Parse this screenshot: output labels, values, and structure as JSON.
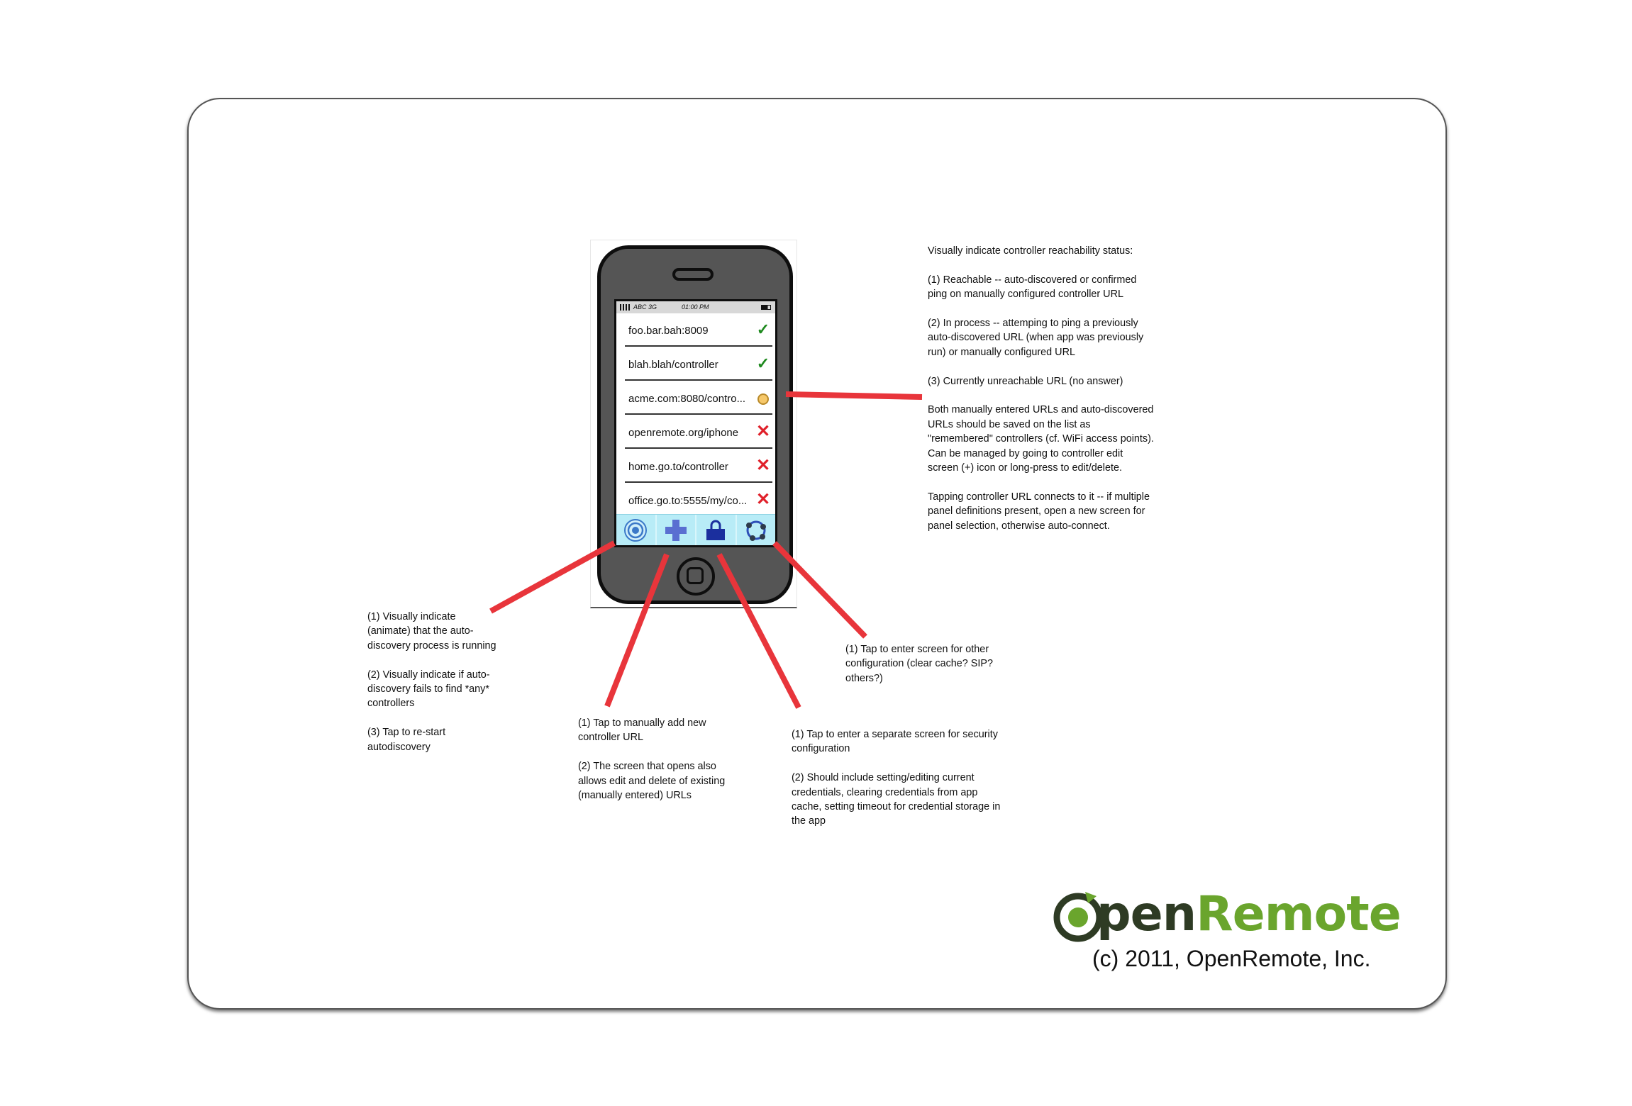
{
  "phone": {
    "status_bar": {
      "carrier": "ABC 3G",
      "time": "01:00 PM"
    },
    "controllers": [
      {
        "url": "foo.bar.bah:8009",
        "status": "reachable",
        "icon": "check-icon"
      },
      {
        "url": "blah.blah/controller",
        "status": "reachable",
        "icon": "check-icon"
      },
      {
        "url": "acme.com:8080/contro...",
        "status": "in-process",
        "icon": "pending-icon"
      },
      {
        "url": "openremote.org/iphone",
        "status": "unreachable",
        "icon": "cross-icon"
      },
      {
        "url": "home.go.to/controller",
        "status": "unreachable",
        "icon": "cross-icon"
      },
      {
        "url": "office.go.to:5555/my/co...",
        "status": "unreachable",
        "icon": "cross-icon"
      }
    ],
    "tabs": [
      {
        "icon": "autodiscovery-icon"
      },
      {
        "icon": "add-icon"
      },
      {
        "icon": "security-lock-icon"
      },
      {
        "icon": "settings-network-icon"
      }
    ],
    "status_symbols": {
      "check": "✓",
      "cross": "✕"
    },
    "colors": {
      "tab_bar": "#b8ecf7",
      "reachable": "#1f8a1f",
      "pending": "#f6c86a",
      "unreachable": "#e0202a",
      "callout": "#e8353b"
    }
  },
  "notes": {
    "reachability": [
      "Visually indicate controller reachability status:",
      "(1) Reachable -- auto-discovered or confirmed ping on manually configured controller URL",
      "(2) In process -- attemping to ping a previously auto-discovered URL (when app was previously run) or manually configured URL",
      "(3) Currently unreachable URL (no answer)",
      "Both manually entered URLs and auto-discovered URLs should be saved on the list as \"remembered\" controllers (cf. WiFi access points). Can be managed by going to controller edit screen (+) icon or long-press to edit/delete.",
      "Tapping controller URL connects to it -- if multiple panel definitions present, open a new screen for panel selection, otherwise auto-connect."
    ],
    "autodiscovery": [
      "(1) Visually indicate (animate) that the auto-discovery process is running",
      "(2) Visually indicate if auto-discovery fails to find *any* controllers",
      "(3) Tap to re-start autodiscovery"
    ],
    "add_controller": [
      "(1) Tap to manually add new controller URL",
      "(2) The screen that opens also allows edit and delete of existing (manually entered) URLs"
    ],
    "security": [
      "(1) Tap to enter a separate screen for security configuration",
      "(2) Should include setting/editing current credentials, clearing credentials from app cache, setting timeout for credential storage in the app"
    ],
    "other_config": [
      "(1) Tap to enter screen for other configuration (clear cache? SIP? others?)"
    ]
  },
  "branding": {
    "logo_dark": "pen",
    "logo_green": "Remote",
    "copyright": "(c) 2011, OpenRemote, Inc."
  }
}
